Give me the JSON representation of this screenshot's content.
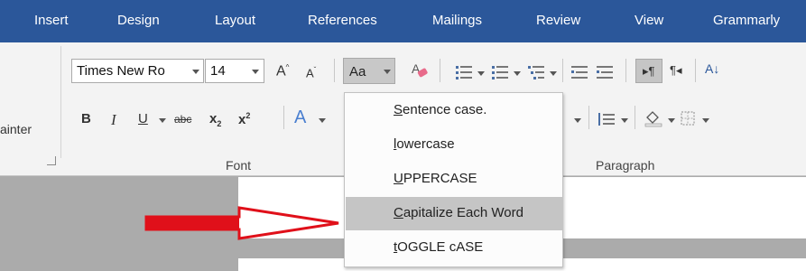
{
  "tabs": [
    {
      "label": "Insert"
    },
    {
      "label": "Design"
    },
    {
      "label": "Layout"
    },
    {
      "label": "References"
    },
    {
      "label": "Mailings"
    },
    {
      "label": "Review"
    },
    {
      "label": "View"
    },
    {
      "label": "Grammarly"
    }
  ],
  "clipboard": {
    "painter_label": "ainter"
  },
  "font": {
    "name": "Times New Ro",
    "size": "14",
    "change_case_label": "Aa",
    "group_label": "Font",
    "bold": "B",
    "italic": "I",
    "underline": "U",
    "strike": "abc",
    "subscript": "x",
    "superscript": "x",
    "grow": "A",
    "shrink": "A",
    "effects": "A"
  },
  "paragraph": {
    "group_label": "Paragraph",
    "sort": "A↓",
    "show_marks": "¶"
  },
  "change_case_menu": [
    {
      "first": "S",
      "rest": "entence case."
    },
    {
      "first": "l",
      "rest": "owercase"
    },
    {
      "first": "U",
      "rest": "PPERCASE"
    },
    {
      "first": "C",
      "rest": "apitalize Each Word"
    },
    {
      "first": "t",
      "rest": "OGGLE cASE"
    }
  ],
  "colors": {
    "ribbon_tab_bg": "#2b579a",
    "highlight": "#c5c5c5",
    "annotation_arrow": "#e0101a"
  }
}
